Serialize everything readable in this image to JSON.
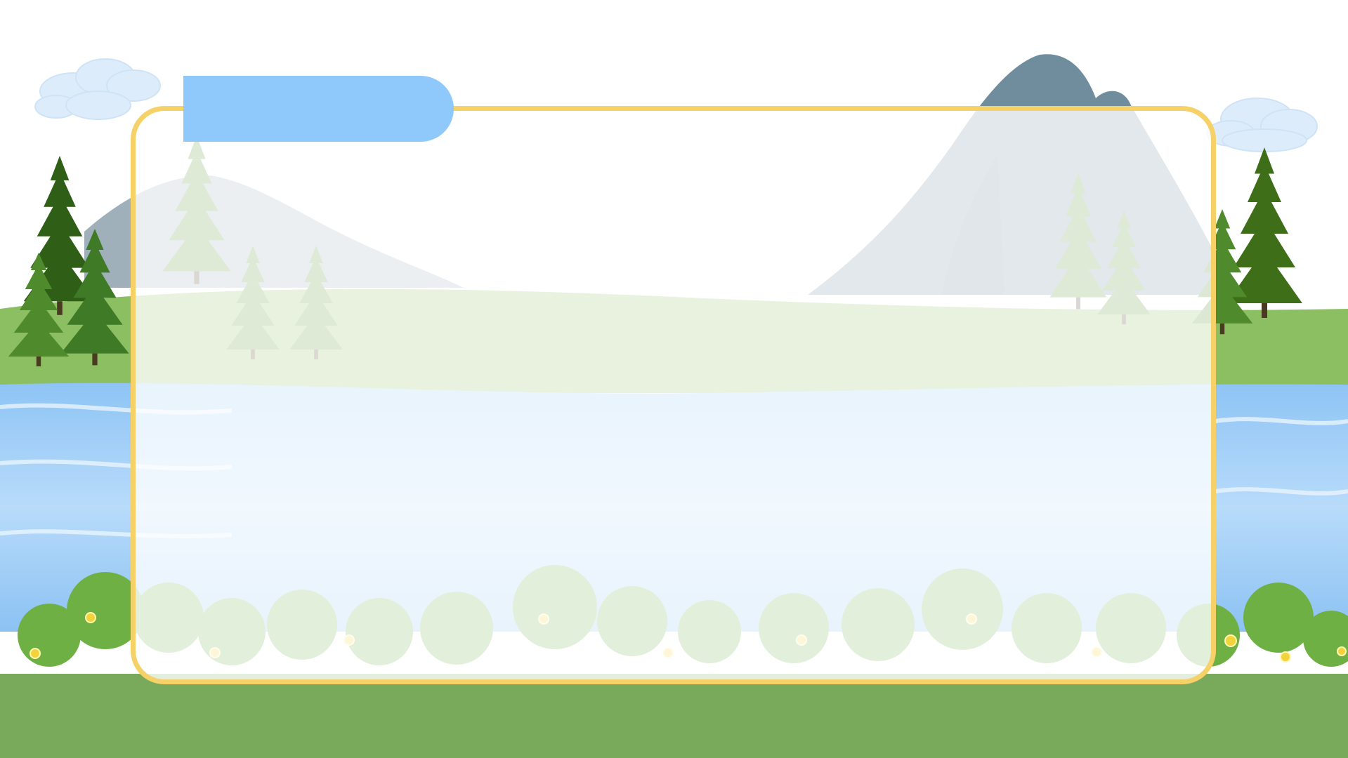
{
  "slide": {
    "title": "",
    "colors": {
      "sky": "#ffffff",
      "grass": "#79a95b",
      "grass_light": "#8cbf62",
      "water": "#a9d1f7",
      "water_deep": "#6fb0ef",
      "mountain": "#6f8d9c",
      "tree_dark": "#2f5e16",
      "tree_light": "#4f8a2c",
      "bush": "#6fb045",
      "flower": "#f2d33b",
      "panel_border": "#f5d167",
      "tab": "#8fc9fc"
    },
    "icons": [
      "cloud-icon",
      "mountain-icon",
      "pine-tree-icon",
      "bush-icon",
      "flower-icon"
    ]
  }
}
